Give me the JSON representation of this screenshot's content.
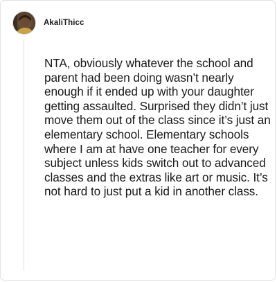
{
  "comment": {
    "author": {
      "username": "AkaliThicc",
      "avatar_icon": "user-avatar-photo"
    },
    "body": "NTA, obviously whatever the school and parent had been doing wasn’t nearly enough if it ended up with your daughter getting assaulted. Surprised they didn’t just move them out of the class since it’s just an elementary school. Elementary schools where I am at have one teacher for every subject unless kids switch out to advanced classes and the extras like art or music. It’s not hard to just put a kid in another class."
  },
  "colors": {
    "text": "#1a1a1a",
    "border": "#e2e2e2",
    "thread_line": "#dcdcdc"
  }
}
